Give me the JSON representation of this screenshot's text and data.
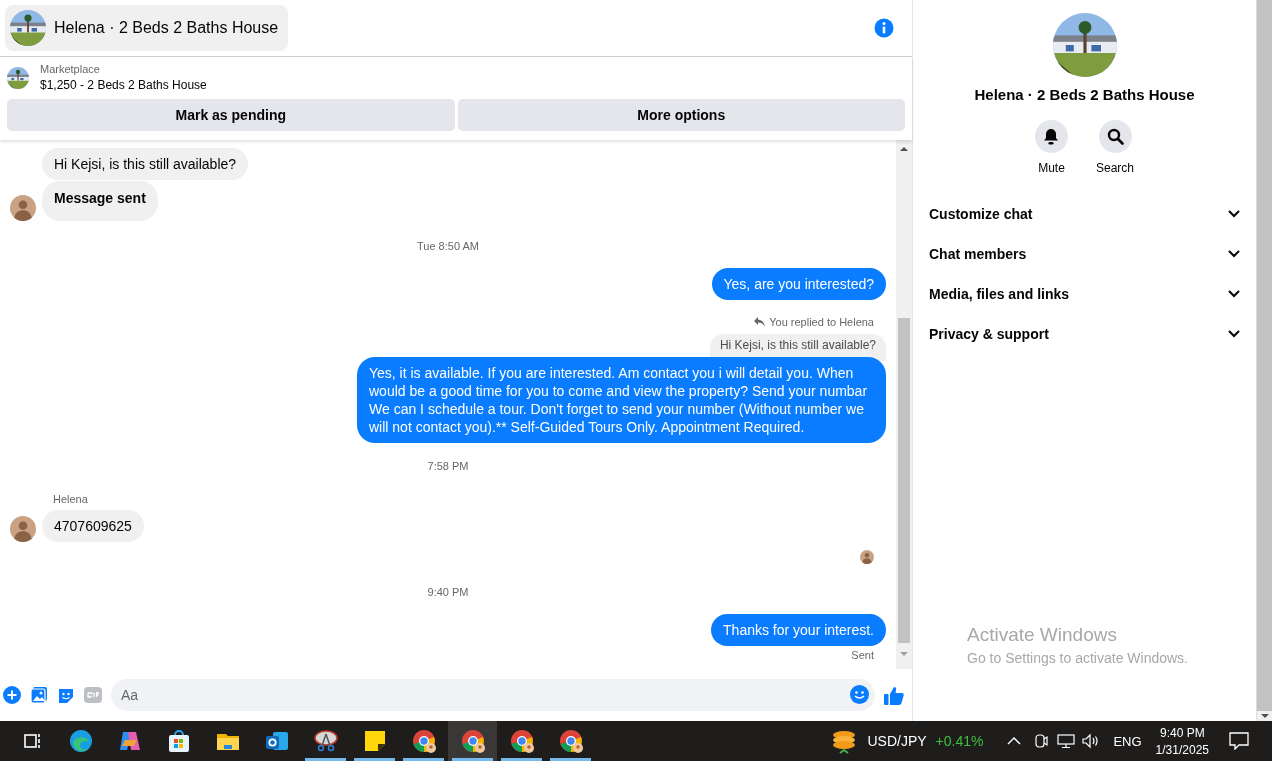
{
  "chat": {
    "title": "Helena · 2 Beds 2 Baths House",
    "listing": {
      "label": "Marketplace",
      "title": "$1,250 - 2 Beds 2 Baths House"
    },
    "actions": [
      "Mark as pending",
      "More options"
    ],
    "messages": [
      {
        "kind": "incoming",
        "text": "Hi Kejsi, is this still available?",
        "avatar": false
      },
      {
        "kind": "notice",
        "text": "Message sent",
        "avatar": true
      },
      {
        "kind": "time",
        "text": "Tue 8:50 AM"
      },
      {
        "kind": "outgoing",
        "text": "Yes, are you interested?"
      },
      {
        "kind": "reply_note",
        "text": "You replied to Helena"
      },
      {
        "kind": "quoted",
        "text": "Hi Kejsi, is this still available?"
      },
      {
        "kind": "outgoing",
        "text": "Yes, it is available. If you are interested.  Am contact you i will detail you.  When would be a good time for you to come and view the property? Send your numbar We can I schedule a tour.  Don't forget to send your number (Without number we will not contact you).** Self-Guided Tours Only. Appointment Required."
      },
      {
        "kind": "time",
        "text": "7:58 PM"
      },
      {
        "kind": "sender",
        "text": "Helena"
      },
      {
        "kind": "incoming",
        "text": "4707609625",
        "avatar": true
      },
      {
        "kind": "read_receipt"
      },
      {
        "kind": "time",
        "text": "9:40 PM"
      },
      {
        "kind": "outgoing",
        "text": "Thanks for your interest."
      },
      {
        "kind": "status",
        "text": "Sent"
      }
    ],
    "composer": {
      "placeholder": "Aa"
    }
  },
  "details": {
    "title": "Helena · 2 Beds 2 Baths House",
    "actions": [
      {
        "kind": "bell",
        "label": "Mute"
      },
      {
        "kind": "search",
        "label": "Search"
      }
    ],
    "sections": [
      {
        "label": "Customize chat",
        "expanded": false
      },
      {
        "label": "Chat members",
        "expanded": false
      },
      {
        "label": "Media, files and links",
        "expanded": false
      },
      {
        "label": "Privacy & support",
        "expanded": false
      }
    ]
  },
  "activation": {
    "title": "Activate Windows",
    "subtitle": "Go to Settings to activate Windows."
  },
  "taskbar": {
    "apps": [
      {
        "kind": "taskview",
        "running": false,
        "selected": false
      },
      {
        "kind": "edge",
        "running": false,
        "selected": false
      },
      {
        "kind": "copilot",
        "running": false,
        "selected": false
      },
      {
        "kind": "store",
        "running": false,
        "selected": false
      },
      {
        "kind": "explorer",
        "running": false,
        "selected": false
      },
      {
        "kind": "outlook",
        "running": false,
        "selected": false
      },
      {
        "kind": "snip",
        "running": true,
        "selected": false
      },
      {
        "kind": "sticky",
        "running": true,
        "selected": false
      },
      {
        "kind": "chrome",
        "running": true,
        "selected": false
      },
      {
        "kind": "chrome",
        "running": true,
        "selected": true
      },
      {
        "kind": "chrome",
        "running": true,
        "selected": false
      },
      {
        "kind": "chrome",
        "running": true,
        "selected": false
      }
    ],
    "ticker": {
      "symbol": "USD/JPY",
      "change": "+0.41%"
    },
    "language": "ENG",
    "time": "9:40 PM",
    "date": "1/31/2025"
  }
}
